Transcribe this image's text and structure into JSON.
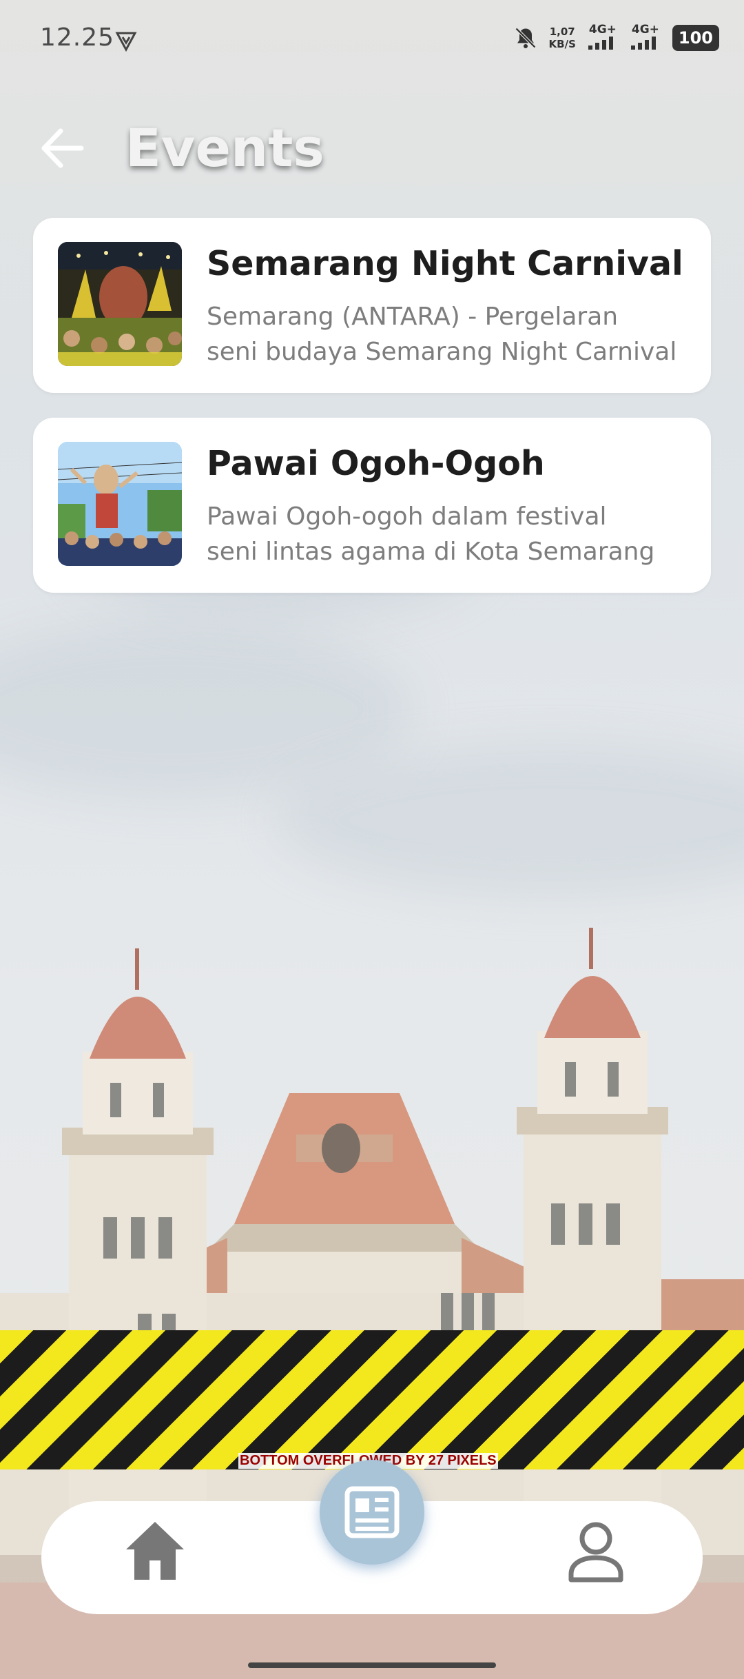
{
  "status_bar": {
    "time": "12.25",
    "network_speed": "1,07\nKB/S",
    "signal_1": "4G+",
    "signal_2": "4G+",
    "battery": "100"
  },
  "header": {
    "title": "Events"
  },
  "events": [
    {
      "title": "Semarang Night Carnival",
      "desc_line1": "Semarang (ANTARA) - Pergelaran",
      "desc_line2": "seni budaya Semarang Night Carnival"
    },
    {
      "title": "Pawai Ogoh-Ogoh",
      "desc_line1": "Pawai Ogoh-ogoh dalam festival",
      "desc_line2": "seni lintas agama di Kota Semarang"
    }
  ],
  "overflow_warning": "BOTTOM OVERFLOWED BY 27 PIXELS",
  "nav": {
    "home_icon": "home-icon",
    "news_icon": "news-icon",
    "profile_icon": "profile-icon"
  },
  "colors": {
    "fab": "#a9c3d7",
    "card": "#ffffff",
    "title_text": "#1e1e1e",
    "desc_text": "#7d7d7d"
  }
}
